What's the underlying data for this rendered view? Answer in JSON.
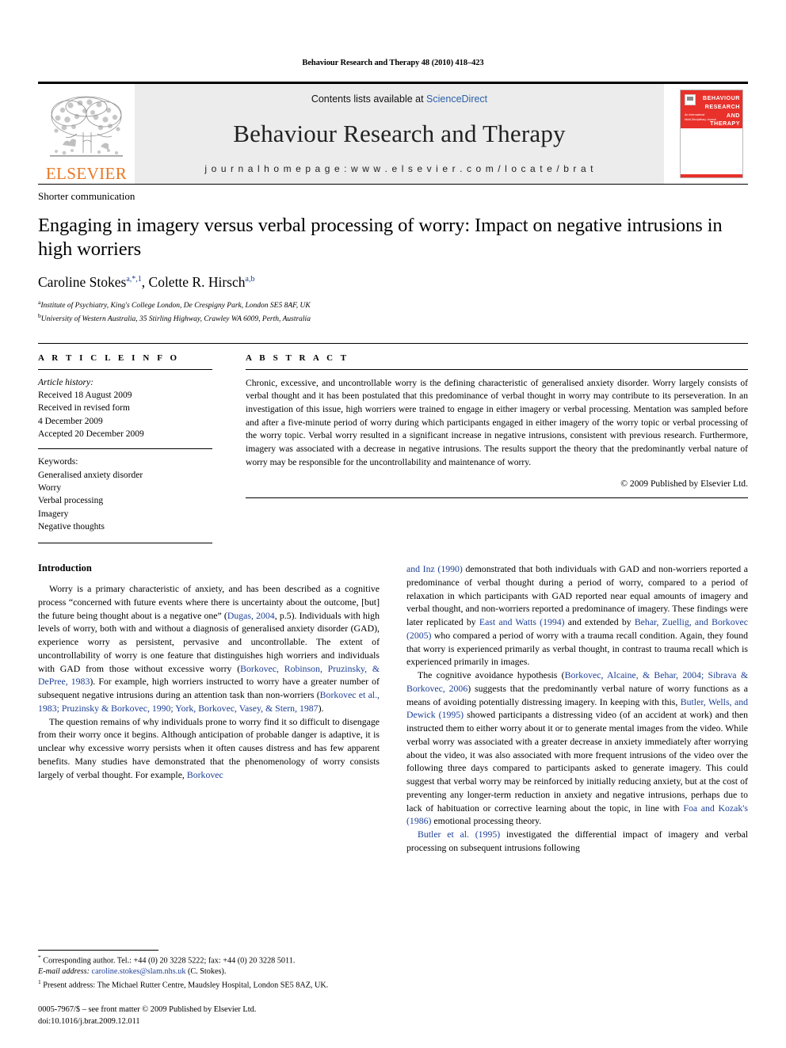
{
  "running_head": "Behaviour Research and Therapy 48 (2010) 418–423",
  "banner": {
    "elsevier_wordmark": "ELSEVIER",
    "elsevier_color": "#E87722",
    "contents_prefix": "Contents lists available at ",
    "contents_link": "ScienceDirect",
    "contents_link_color": "#2b5fa8",
    "journal_title": "Behaviour Research and Therapy",
    "homepage": "j o u r n a l   h o m e p a g e :   w w w . e l s e v i e r . c o m / l o c a t e / b r a t",
    "cover": {
      "title_line1": "BEHAVIOUR",
      "title_line2": "RESEARCH AND",
      "title_line3": "THERAPY",
      "subtitle_line1": "An International",
      "subtitle_line2": "Multi-Disciplinary Journal",
      "accent_color": "#e8312a"
    }
  },
  "article": {
    "category": "Shorter communication",
    "title": "Engaging in imagery versus verbal processing of worry: Impact on negative intrusions in high worriers",
    "authors_part1": "Caroline Stokes",
    "authors_sup1": "a,*,1",
    "authors_separator": ", ",
    "authors_part2": "Colette R. Hirsch",
    "authors_sup2": "a,b",
    "affiliation_a_marker": "a",
    "affiliation_a": "Institute of Psychiatry, King's College London, De Crespigny Park, London SE5 8AF, UK",
    "affiliation_b_marker": "b",
    "affiliation_b": "University of Western Australia, 35 Stirling Highway, Crawley WA 6009, Perth, Australia"
  },
  "info": {
    "heading": "A R T I C L E   I N F O",
    "history_label": "Article history:",
    "history": [
      "Received 18 August 2009",
      "Received in revised form",
      "4 December 2009",
      "Accepted 20 December 2009"
    ],
    "keywords_label": "Keywords:",
    "keywords": [
      "Generalised anxiety disorder",
      "Worry",
      "Verbal processing",
      "Imagery",
      "Negative thoughts"
    ]
  },
  "abstract": {
    "heading": "A B S T R A C T",
    "text": "Chronic, excessive, and uncontrollable worry is the defining characteristic of generalised anxiety disorder. Worry largely consists of verbal thought and it has been postulated that this predominance of verbal thought in worry may contribute to its perseveration. In an investigation of this issue, high worriers were trained to engage in either imagery or verbal processing. Mentation was sampled before and after a five-minute period of worry during which participants engaged in either imagery of the worry topic or verbal processing of the worry topic. Verbal worry resulted in a significant increase in negative intrusions, consistent with previous research. Furthermore, imagery was associated with a decrease in negative intrusions. The results support the theory that the predominantly verbal nature of worry may be responsible for the uncontrollability and maintenance of worry.",
    "copyright": "© 2009 Published by Elsevier Ltd."
  },
  "body": {
    "section_heading": "Introduction",
    "left_paragraphs": [
      {
        "segments": [
          {
            "t": "Worry is a primary characteristic of anxiety, and has been described as a cognitive process “concerned with future events where there is uncertainty about the outcome, [but] the future being thought about is a negative one” (",
            "ref": false
          },
          {
            "t": "Dugas, 2004",
            "ref": true
          },
          {
            "t": ", p.5). Individuals with high levels of worry, both with and without a diagnosis of generalised anxiety disorder (GAD), experience worry as persistent, pervasive and uncontrollable. The extent of uncontrollability of worry is one feature that distinguishes high worriers and individuals with GAD from those without excessive worry (",
            "ref": false
          },
          {
            "t": "Borkovec, Robinson, Pruzinsky, & DePree, 1983",
            "ref": true
          },
          {
            "t": "). For example, high worriers instructed to worry have a greater number of subsequent negative intrusions during an attention task than non-worriers (",
            "ref": false
          },
          {
            "t": "Borkovec et al., 1983; Pruzinsky & Borkovec, 1990; York, Borkovec, Vasey, & Stern, 1987",
            "ref": true
          },
          {
            "t": ").",
            "ref": false
          }
        ]
      },
      {
        "segments": [
          {
            "t": "The question remains of why individuals prone to worry find it so difficult to disengage from their worry once it begins. Although anticipation of probable danger is adaptive, it is unclear why excessive worry persists when it often causes distress and has few apparent benefits. Many studies have demonstrated that the phenomenology of worry consists largely of verbal thought. For example, ",
            "ref": false
          },
          {
            "t": "Borkovec",
            "ref": true
          }
        ]
      }
    ],
    "right_paragraphs": [
      {
        "continued": true,
        "segments": [
          {
            "t": "and Inz (1990)",
            "ref": true
          },
          {
            "t": " demonstrated that both individuals with GAD and non-worriers reported a predominance of verbal thought during a period of worry, compared to a period of relaxation in which participants with GAD reported near equal amounts of imagery and verbal thought, and non-worriers reported a predominance of imagery. These findings were later replicated by ",
            "ref": false
          },
          {
            "t": "East and Watts (1994)",
            "ref": true
          },
          {
            "t": " and extended by ",
            "ref": false
          },
          {
            "t": "Behar, Zuellig, and Borkovec (2005)",
            "ref": true
          },
          {
            "t": " who compared a period of worry with a trauma recall condition. Again, they found that worry is experienced primarily as verbal thought, in contrast to trauma recall which is experienced primarily in images.",
            "ref": false
          }
        ]
      },
      {
        "continued": false,
        "segments": [
          {
            "t": "The cognitive avoidance hypothesis (",
            "ref": false
          },
          {
            "t": "Borkovec, Alcaine, & Behar, 2004; Sibrava & Borkovec, 2006",
            "ref": true
          },
          {
            "t": ") suggests that the predominantly verbal nature of worry functions as a means of avoiding potentially distressing imagery. In keeping with this, ",
            "ref": false
          },
          {
            "t": "Butler, Wells, and Dewick (1995)",
            "ref": true
          },
          {
            "t": " showed participants a distressing video (of an accident at work) and then instructed them to either worry about it or to generate mental images from the video. While verbal worry was associated with a greater decrease in anxiety immediately after worrying about the video, it was also associated with more frequent intrusions of the video over the following three days compared to participants asked to generate imagery. This could suggest that verbal worry may be reinforced by initially reducing anxiety, but at the cost of preventing any longer-term reduction in anxiety and negative intrusions, perhaps due to lack of habituation or corrective learning about the topic, in line with ",
            "ref": false
          },
          {
            "t": "Foa and Kozak's (1986)",
            "ref": true
          },
          {
            "t": " emotional processing theory.",
            "ref": false
          }
        ]
      },
      {
        "continued": false,
        "segments": [
          {
            "t": "Butler et al. (1995)",
            "ref": true
          },
          {
            "t": " investigated the differential impact of imagery and verbal processing on subsequent intrusions following",
            "ref": false
          }
        ]
      }
    ]
  },
  "footnotes": {
    "corresponding_marker": "*",
    "corresponding": " Corresponding author. Tel.: +44 (0) 20 3228 5222; fax: +44 (0) 20 3228 5011.",
    "email_label": "E-mail address:",
    "email": "caroline.stokes@slam.nhs.uk",
    "email_suffix": " (C. Stokes).",
    "present_marker": "1",
    "present_address": " Present address: The Michael Rutter Centre, Maudsley Hospital, London SE5 8AZ, UK."
  },
  "imprint": {
    "line1": "0005-7967/$ – see front matter © 2009 Published by Elsevier Ltd.",
    "line2": "doi:10.1016/j.brat.2009.12.011"
  }
}
